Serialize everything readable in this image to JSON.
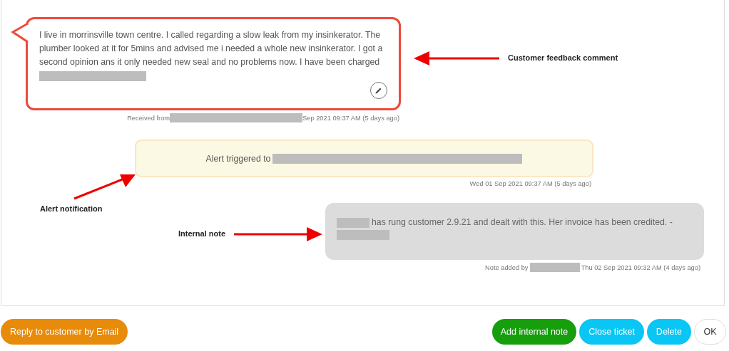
{
  "feedback": {
    "segments": [
      {
        "kind": "text",
        "text": "I live in morrinsville town centre. I called regarding a slow leak from my insinkerator. The plumber looked at it for 5mins and advised me i needed a whole new insinkerator. I got a second opinion ans it only needed new seal and no problems now. I have been charged"
      },
      {
        "kind": "redacted"
      }
    ],
    "meta": [
      {
        "kind": "text",
        "text": "Received from"
      },
      {
        "kind": "redacted"
      },
      {
        "kind": "text",
        "text": "Sep 2021 09:37 AM (5 days ago)"
      }
    ]
  },
  "alert": {
    "segments": [
      {
        "kind": "text",
        "text": "Alert triggered to"
      },
      {
        "kind": "redacted"
      }
    ],
    "meta": [
      {
        "kind": "text",
        "text": "Wed 01 Sep 2021 09:37 AM (5 days ago)"
      }
    ]
  },
  "note": {
    "segments": [
      {
        "kind": "redacted"
      },
      {
        "kind": "text",
        "text": "has rung customer 2.9.21 and dealt with this. Her invoice has been credited. -"
      },
      {
        "kind": "redacted"
      }
    ],
    "meta": [
      {
        "kind": "text",
        "text": "Note added by"
      },
      {
        "kind": "redacted"
      },
      {
        "kind": "text",
        "text": "Thu 02 Sep 2021 09:32 AM (4 days ago)"
      }
    ]
  },
  "annotations": [
    {
      "kind": "feedback",
      "text": "Customer feedback comment"
    },
    {
      "kind": "alert",
      "text": "Alert notification"
    },
    {
      "kind": "note",
      "text": "Internal note"
    }
  ],
  "buttons": [
    {
      "kind": "orange",
      "label": "Reply to customer by Email"
    },
    {
      "kind": "green",
      "label": "Add internal note"
    },
    {
      "kind": "cyan",
      "label": "Close ticket"
    },
    {
      "kind": "cyan",
      "label": "Delete"
    },
    {
      "kind": "plain",
      "label": "OK"
    }
  ]
}
